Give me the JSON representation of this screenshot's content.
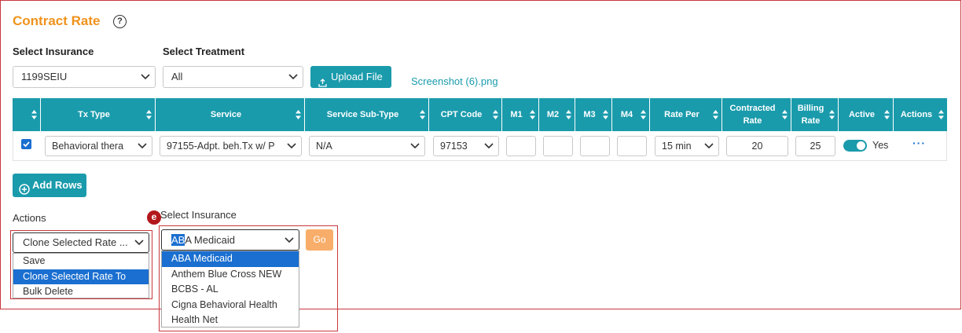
{
  "page": {
    "title": "Contract Rate",
    "help_icon": "?"
  },
  "filters": {
    "insurance_label": "Select Insurance",
    "insurance_value": "1199SEIU",
    "treatment_label": "Select Treatment",
    "treatment_value": "All",
    "upload_label": "Upload File",
    "uploaded_file": "Screenshot (6).png"
  },
  "table": {
    "headers": [
      "",
      "Tx Type",
      "Service",
      "Service Sub-Type",
      "CPT Code",
      "M1",
      "M2",
      "M3",
      "M4",
      "Rate Per",
      "Contracted Rate",
      "Billing Rate",
      "Active",
      "Actions"
    ],
    "row": {
      "checked": true,
      "tx_type": "Behavioral thera",
      "service": "97155-Adpt. beh.Tx w/ P",
      "sub_type": "N/A",
      "cpt_code": "97153",
      "m1": "",
      "m2": "",
      "m3": "",
      "m4": "",
      "rate_per": "15 min",
      "contracted_rate": "20",
      "billing_rate": "25",
      "active_label": "Yes",
      "more_actions": "···"
    }
  },
  "add_rows_label": "Add Rows",
  "bulk": {
    "actions_label": "Actions",
    "actions_value": "Clone Selected Rate ...",
    "actions_options": [
      "Save",
      "Clone Selected Rate To",
      "Bulk Delete"
    ],
    "actions_selected_index": 1,
    "marker": "e",
    "insurance_label": "Select Insurance",
    "insurance_typed": "AB",
    "insurance_value_rest": "A Medicaid",
    "insurance_options": [
      "ABA Medicaid",
      "Anthem Blue Cross NEW",
      "BCBS - AL",
      "Cigna Behavioral Health",
      "Health Net"
    ],
    "insurance_selected_index": 0,
    "go_label": "Go"
  },
  "colors": {
    "accent": "#1a9bac",
    "title": "#f0921c",
    "highlight": "#c8373d",
    "selection": "#1a6fd0",
    "go_button": "#f8ae6a"
  }
}
